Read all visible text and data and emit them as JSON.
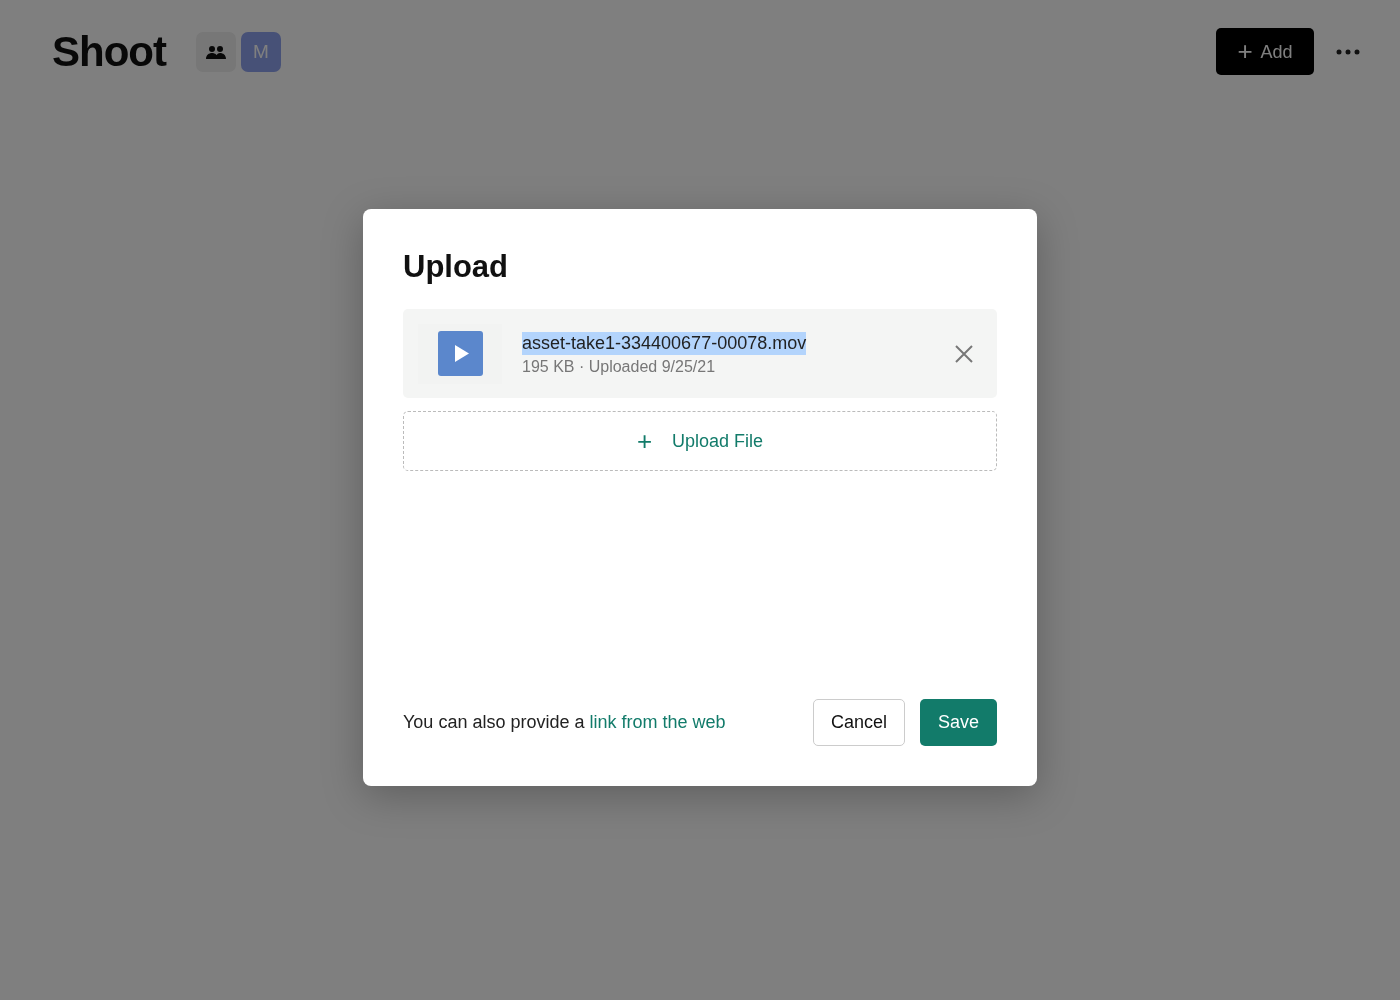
{
  "header": {
    "title": "Shoot",
    "avatar": "M",
    "add_button": "+",
    "add_label": "Add"
  },
  "dialog": {
    "title": "Upload",
    "files": [
      {
        "name": "asset-take1-334400677-00078.mov",
        "highlighted": true,
        "meta": "195 KB · Uploaded 9/25/21"
      }
    ],
    "upload_button": {
      "icon": "+",
      "label": "Upload File"
    },
    "footer": {
      "text": "You can also provide a ",
      "link": "link from the web"
    },
    "buttons": [
      {
        "label": "Cancel",
        "kind": "secondary"
      },
      {
        "label": "Save",
        "kind": "primary"
      }
    ]
  }
}
